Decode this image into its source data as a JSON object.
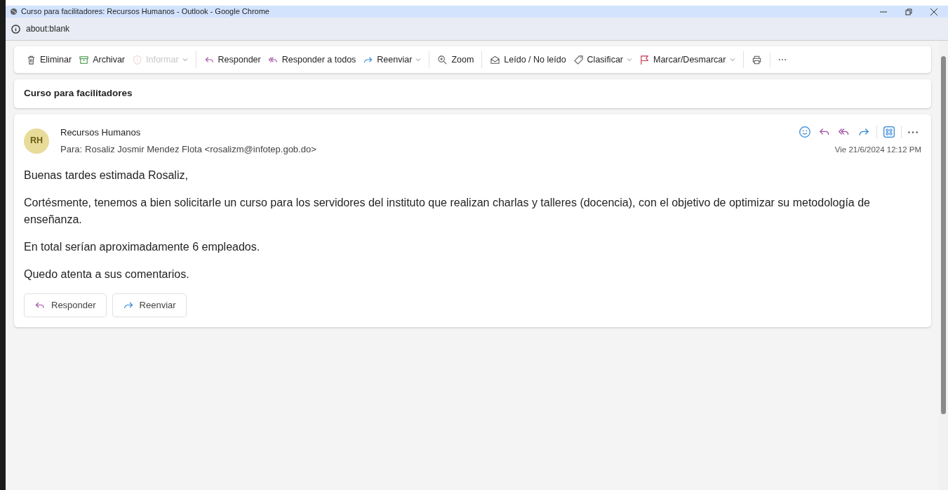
{
  "window": {
    "title": "Curso para facilitadores: Recursos Humanos - Outlook - Google Chrome",
    "address": "about:blank"
  },
  "toolbar": {
    "groups": [
      [
        {
          "kind": "delete",
          "label": "Eliminar",
          "disabled": false,
          "dropdown": false
        },
        {
          "kind": "archive",
          "label": "Archivar",
          "disabled": false,
          "dropdown": false
        },
        {
          "kind": "report",
          "label": "Informar",
          "disabled": true,
          "dropdown": true
        }
      ],
      [
        {
          "kind": "reply",
          "label": "Responder",
          "disabled": false,
          "dropdown": false
        },
        {
          "kind": "replyall",
          "label": "Responder a todos",
          "disabled": false,
          "dropdown": false
        },
        {
          "kind": "forward",
          "label": "Reenviar",
          "disabled": false,
          "dropdown": true
        }
      ],
      [
        {
          "kind": "zoom",
          "label": "Zoom",
          "disabled": false,
          "dropdown": false
        }
      ],
      [
        {
          "kind": "read",
          "label": "Leído / No leído",
          "disabled": false,
          "dropdown": false
        },
        {
          "kind": "tag",
          "label": "Clasificar",
          "disabled": false,
          "dropdown": true
        },
        {
          "kind": "flag",
          "label": "Marcar/Desmarcar",
          "disabled": false,
          "dropdown": true
        }
      ],
      [
        {
          "kind": "print",
          "disabled": false,
          "dropdown": false
        }
      ],
      [
        {
          "kind": "more",
          "disabled": false,
          "dropdown": false
        }
      ]
    ]
  },
  "subject": "Curso para facilitadores",
  "message": {
    "avatar": "RH",
    "sender": "Recursos Humanos",
    "to_label": "Para:",
    "to": "Rosaliz Josmir Mendez Flota <rosalizm@infotep.gob.do>",
    "date": "Vie 21/6/2024 12:12 PM",
    "paragraphs": [
      "Buenas tardes estimada Rosaliz,",
      "Cortésmente, tenemos a bien solicitarle un curso para los servidores del instituto que realizan charlas y talleres (docencia), con el objetivo de optimizar su metodología de enseñanza.",
      "En total serían aproximadamente 6 empleados.",
      "Quedo atenta a sus comentarios."
    ],
    "buttons": [
      {
        "kind": "reply",
        "label": "Responder"
      },
      {
        "kind": "forward",
        "label": "Reenviar"
      }
    ]
  }
}
